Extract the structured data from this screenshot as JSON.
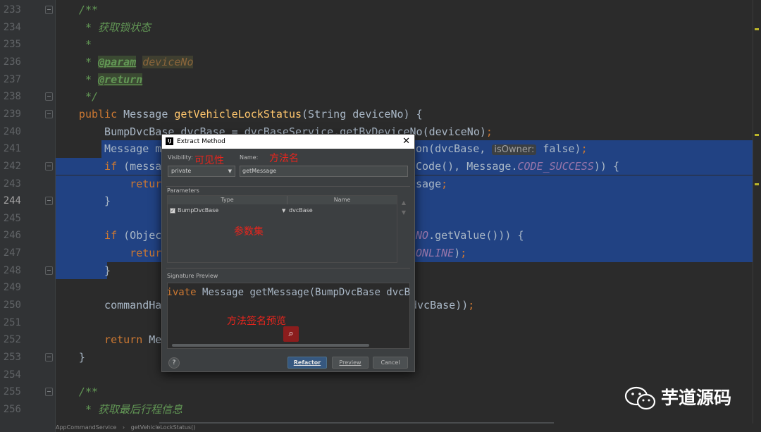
{
  "editor": {
    "current_line": "244",
    "lines": [
      {
        "no": "233",
        "parts": [
          {
            "t": "    /**",
            "c": "c"
          }
        ]
      },
      {
        "no": "234",
        "parts": [
          {
            "t": "     * ",
            "c": "c"
          },
          {
            "t": "获取锁状态",
            "c": "cz"
          }
        ]
      },
      {
        "no": "235",
        "parts": [
          {
            "t": "     *",
            "c": "c"
          }
        ]
      },
      {
        "no": "236",
        "parts": [
          {
            "t": "     * ",
            "c": "c"
          },
          {
            "t": "@param",
            "c": "tag"
          },
          {
            "t": " ",
            "c": "c"
          },
          {
            "t": "deviceNo",
            "c": "pname"
          }
        ]
      },
      {
        "no": "237",
        "parts": [
          {
            "t": "     * ",
            "c": "c"
          },
          {
            "t": "@return",
            "c": "tag"
          }
        ]
      },
      {
        "no": "238",
        "parts": [
          {
            "t": "     */",
            "c": "c"
          }
        ]
      },
      {
        "no": "239",
        "parts": [
          {
            "t": "    ",
            "c": ""
          },
          {
            "t": "public ",
            "c": "k"
          },
          {
            "t": "Message ",
            "c": ""
          },
          {
            "t": "getVehicleLockStatus",
            "c": "m"
          },
          {
            "t": "(String deviceNo) {",
            "c": ""
          }
        ]
      },
      {
        "no": "240",
        "parts": [
          {
            "t": "        BumpDvcBase dvcBase = dvcBaseService.getByDeviceNo(deviceNo)",
            "c": ""
          },
          {
            "t": ";",
            "c": "k"
          }
        ]
      },
      {
        "no": "241",
        "parts": [
          {
            "t": "        Message me",
            "c": ""
          }
        ]
      },
      {
        "no": "242",
        "parts": [
          {
            "t": "        ",
            "c": ""
          },
          {
            "t": "if ",
            "c": "k"
          },
          {
            "t": "(messag",
            "c": ""
          }
        ]
      },
      {
        "no": "243",
        "parts": [
          {
            "t": "            ",
            "c": ""
          },
          {
            "t": "return",
            "c": "k"
          }
        ]
      },
      {
        "no": "244",
        "parts": [
          {
            "t": "        }",
            "c": ""
          }
        ]
      },
      {
        "no": "245",
        "parts": [
          {
            "t": "",
            "c": ""
          }
        ]
      },
      {
        "no": "246",
        "parts": [
          {
            "t": "        ",
            "c": ""
          },
          {
            "t": "if ",
            "c": "k"
          },
          {
            "t": "(Object",
            "c": ""
          }
        ]
      },
      {
        "no": "247",
        "parts": [
          {
            "t": "            ",
            "c": ""
          },
          {
            "t": "return",
            "c": "k"
          }
        ]
      },
      {
        "no": "248",
        "parts": [
          {
            "t": "        }",
            "c": ""
          }
        ]
      },
      {
        "no": "249",
        "parts": [
          {
            "t": "",
            "c": ""
          }
        ]
      },
      {
        "no": "250",
        "parts": [
          {
            "t": "        commandHan",
            "c": ""
          }
        ]
      },
      {
        "no": "251",
        "parts": [
          {
            "t": "",
            "c": ""
          }
        ]
      },
      {
        "no": "252",
        "parts": [
          {
            "t": "        ",
            "c": ""
          },
          {
            "t": "return ",
            "c": "k"
          },
          {
            "t": "Mes",
            "c": ""
          }
        ]
      },
      {
        "no": "253",
        "parts": [
          {
            "t": "    }",
            "c": ""
          }
        ]
      },
      {
        "no": "254",
        "parts": [
          {
            "t": "",
            "c": ""
          }
        ]
      },
      {
        "no": "255",
        "parts": [
          {
            "t": "    /**",
            "c": "c"
          }
        ]
      },
      {
        "no": "256",
        "parts": [
          {
            "t": "     * ",
            "c": "c"
          },
          {
            "t": "获取最后行程信息",
            "c": "cz"
          }
        ]
      }
    ],
    "right_fragments": {
      "241": [
        {
          "t": "on(dvcBase, ",
          "c": ""
        },
        {
          "t": "isOwner:",
          "c": "hint"
        },
        {
          "t": " false)",
          "c": ""
        },
        {
          "t": ";",
          "c": "k"
        }
      ],
      "242": [
        {
          "t": "Code(), Message.",
          "c": ""
        },
        {
          "t": "CODE_SUCCESS",
          "c": "const"
        },
        {
          "t": ")) {",
          "c": ""
        }
      ],
      "243": [
        {
          "t": "sage",
          "c": ""
        },
        {
          "t": ";",
          "c": "k"
        }
      ],
      "246": [
        {
          "t": "NO",
          "c": "const"
        },
        {
          "t": ".getValue())) {",
          "c": ""
        }
      ],
      "247": [
        {
          "t": "ONLINE",
          "c": "const"
        },
        {
          "t": ")",
          "c": ""
        },
        {
          "t": ";",
          "c": "k"
        }
      ],
      "250": [
        {
          "t": "dvcBase))",
          "c": ""
        },
        {
          "t": ";",
          "c": "k"
        }
      ]
    },
    "breadcrumb": [
      "AppCommandService",
      "getVehicleLockStatus()"
    ]
  },
  "dialog": {
    "title": "Extract Method",
    "close": "✕",
    "visibility_label": "Visibility:",
    "visibility_value": "private",
    "name_label": "Name:",
    "name_value": "getMessage",
    "parameters_label": "Parameters",
    "col_type": "Type",
    "col_name": "Name",
    "param_rows": [
      {
        "type": "BumpDvcBase",
        "name": "dvcBase",
        "checked": true
      }
    ],
    "signature_label": "Signature Preview",
    "signature_parts": [
      {
        "t": "rivate ",
        "c": "k"
      },
      {
        "t": "Message getMessage(BumpDvcBase dvcB",
        "c": ""
      }
    ],
    "help": "?",
    "refactor": "Refactor",
    "preview": "Preview",
    "cancel": "Cancel"
  },
  "annotations": {
    "visibility": "可见性",
    "method_name": "方法名",
    "params_set": "参数集",
    "signature_preview": "方法签名预览"
  },
  "watermark": {
    "text": "芋道源码"
  },
  "colors": {
    "selection": "#214283",
    "annotation": "#e8251d",
    "keyword": "#cc7832",
    "method": "#ffc66d"
  }
}
